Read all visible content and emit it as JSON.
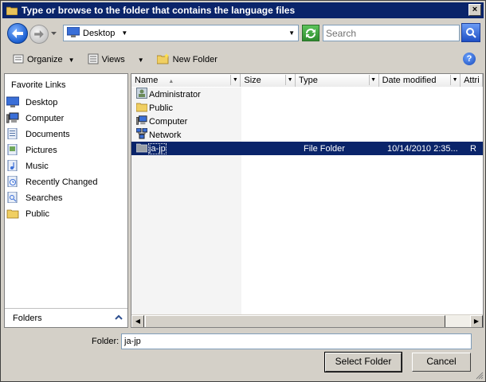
{
  "window": {
    "title": "Type or browse to the folder that contains the language files",
    "close_label": "×"
  },
  "address": {
    "current": "Desktop",
    "search_placeholder": "Search"
  },
  "toolbar": {
    "organize": "Organize",
    "views": "Views",
    "new_folder": "New Folder"
  },
  "favorites": {
    "header": "Favorite Links",
    "items": [
      {
        "label": "Desktop",
        "icon": "desktop-icon"
      },
      {
        "label": "Computer",
        "icon": "computer-icon"
      },
      {
        "label": "Documents",
        "icon": "documents-icon"
      },
      {
        "label": "Pictures",
        "icon": "pictures-icon"
      },
      {
        "label": "Music",
        "icon": "music-icon"
      },
      {
        "label": "Recently Changed",
        "icon": "recent-icon"
      },
      {
        "label": "Searches",
        "icon": "searches-icon"
      },
      {
        "label": "Public",
        "icon": "folder-icon"
      }
    ],
    "folders_label": "Folders"
  },
  "columns": [
    "Name",
    "Size",
    "Type",
    "Date modified",
    "Attri"
  ],
  "files": [
    {
      "name": "Administrator",
      "type": "",
      "date": "",
      "attr": "",
      "icon": "user-folder-icon"
    },
    {
      "name": "Public",
      "type": "",
      "date": "",
      "attr": "",
      "icon": "folder-icon"
    },
    {
      "name": "Computer",
      "type": "",
      "date": "",
      "attr": "",
      "icon": "computer-icon"
    },
    {
      "name": "Network",
      "type": "",
      "date": "",
      "attr": "",
      "icon": "network-icon"
    },
    {
      "name": "ja-jp",
      "type": "File Folder",
      "date": "10/14/2010 2:35...",
      "attr": "R",
      "icon": "folder-icon",
      "selected": true
    }
  ],
  "footer": {
    "folder_label": "Folder:",
    "folder_value": "ja-jp",
    "select_button": "Select Folder",
    "cancel_button": "Cancel"
  },
  "colors": {
    "title_bar": "#0a246a",
    "selection": "#0a246a",
    "face": "#d4d0c8"
  }
}
